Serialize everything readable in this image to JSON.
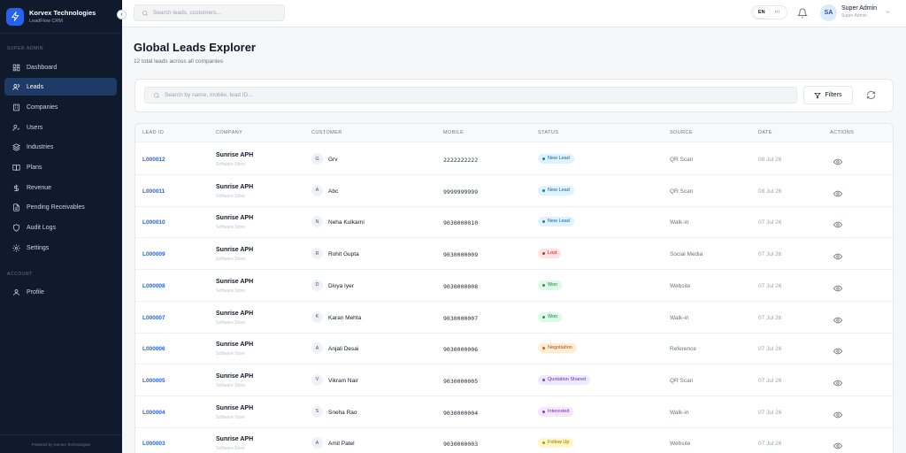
{
  "sidebar": {
    "brand_name": "Korvex Technologies",
    "brand_sub": "LeadFlow CRM",
    "section_admin": "SUPER ADMIN",
    "section_account": "ACCOUNT",
    "items": [
      {
        "label": "Dashboard",
        "icon": "dashboard-icon"
      },
      {
        "label": "Leads",
        "icon": "users-icon",
        "active": true
      },
      {
        "label": "Companies",
        "icon": "building-icon"
      },
      {
        "label": "Users",
        "icon": "user-group-icon"
      },
      {
        "label": "Industries",
        "icon": "layers-icon"
      },
      {
        "label": "Plans",
        "icon": "book-icon"
      },
      {
        "label": "Revenue",
        "icon": "dollar-icon"
      },
      {
        "label": "Pending Receivables",
        "icon": "file-icon"
      },
      {
        "label": "Audit Logs",
        "icon": "shield-icon"
      },
      {
        "label": "Settings",
        "icon": "gear-icon"
      }
    ],
    "profile_label": "Profile",
    "powered_by": "Powered by Korvex Technologies"
  },
  "topbar": {
    "search_placeholder": "Search leads, customers...",
    "lang_en": "EN",
    "lang_hi": "HI",
    "avatar_initials": "SA",
    "user_name": "Super Admin",
    "user_role": "Super Admin"
  },
  "page": {
    "title": "Global Leads Explorer",
    "subtitle": "12 total leads across all companies"
  },
  "filters": {
    "search_placeholder": "Search by name, mobile, lead ID...",
    "filters_label": "Filters"
  },
  "table": {
    "headers": [
      "LEAD ID",
      "COMPANY",
      "CUSTOMER",
      "MOBILE",
      "STATUS",
      "SOURCE",
      "DATE",
      "ACTIONS"
    ],
    "rows": [
      {
        "id": "L000012",
        "company": "Sunrise APH",
        "company_sub": "Software Store",
        "initial": "G",
        "customer": "Grv",
        "mobile": "2222222222",
        "status": "New Lead",
        "status_key": "new",
        "source": "QR Scan",
        "date": "08 Jul 26"
      },
      {
        "id": "L000011",
        "company": "Sunrise APH",
        "company_sub": "Software Store",
        "initial": "A",
        "customer": "Abc",
        "mobile": "9999999999",
        "status": "New Lead",
        "status_key": "new",
        "source": "QR Scan",
        "date": "08 Jul 26"
      },
      {
        "id": "L000010",
        "company": "Sunrise APH",
        "company_sub": "Software Store",
        "initial": "N",
        "customer": "Neha Kulkarni",
        "mobile": "9030000010",
        "status": "New Lead",
        "status_key": "new",
        "source": "Walk-in",
        "date": "07 Jul 26"
      },
      {
        "id": "L000009",
        "company": "Sunrise APH",
        "company_sub": "Software Store",
        "initial": "R",
        "customer": "Rohit Gupta",
        "mobile": "9030000009",
        "status": "Lost",
        "status_key": "lost",
        "source": "Social Media",
        "date": "07 Jul 26"
      },
      {
        "id": "L000008",
        "company": "Sunrise APH",
        "company_sub": "Software Store",
        "initial": "D",
        "customer": "Divya Iyer",
        "mobile": "9030000008",
        "status": "Won",
        "status_key": "won",
        "source": "Website",
        "date": "07 Jul 26"
      },
      {
        "id": "L000007",
        "company": "Sunrise APH",
        "company_sub": "Software Store",
        "initial": "K",
        "customer": "Karan Mehta",
        "mobile": "9030000007",
        "status": "Won",
        "status_key": "won",
        "source": "Walk-in",
        "date": "07 Jul 26"
      },
      {
        "id": "L000006",
        "company": "Sunrise APH",
        "company_sub": "Software Store",
        "initial": "A",
        "customer": "Anjali Desai",
        "mobile": "9030000006",
        "status": "Negotiation",
        "status_key": "negotiation",
        "source": "Reference",
        "date": "07 Jul 26"
      },
      {
        "id": "L000005",
        "company": "Sunrise APH",
        "company_sub": "Software Store",
        "initial": "V",
        "customer": "Vikram Nair",
        "mobile": "9030000005",
        "status": "Quotation Shared",
        "status_key": "quotation",
        "source": "QR Scan",
        "date": "07 Jul 26"
      },
      {
        "id": "L000004",
        "company": "Sunrise APH",
        "company_sub": "Software Store",
        "initial": "S",
        "customer": "Sneha Rao",
        "mobile": "9030000004",
        "status": "Interested",
        "status_key": "interested",
        "source": "Walk-in",
        "date": "07 Jul 26"
      },
      {
        "id": "L000003",
        "company": "Sunrise APH",
        "company_sub": "Software Store",
        "initial": "A",
        "customer": "Amit Patel",
        "mobile": "9030000003",
        "status": "Follow Up",
        "status_key": "followup",
        "source": "Website",
        "date": "07 Jul 26"
      }
    ]
  },
  "colors": {
    "sidebar_bg": "#0f1b2d",
    "active_nav": "#1e3a66",
    "accent": "#2563eb",
    "status": {
      "new": {
        "bg": "#e0f2fe",
        "fg": "#0369a1",
        "dot": "#0284c7"
      },
      "lost": {
        "bg": "#fee2e2",
        "fg": "#b91c1c",
        "dot": "#dc2626"
      },
      "won": {
        "bg": "#dcfce7",
        "fg": "#15803d",
        "dot": "#16a34a"
      },
      "negotiation": {
        "bg": "#ffedd5",
        "fg": "#c2410c",
        "dot": "#ea580c"
      },
      "quotation": {
        "bg": "#ede9fe",
        "fg": "#6d28d9",
        "dot": "#7c3aed"
      },
      "interested": {
        "bg": "#f3e8ff",
        "fg": "#7e22ce",
        "dot": "#9333ea"
      },
      "followup": {
        "bg": "#fef9c3",
        "fg": "#a16207",
        "dot": "#ca8a04"
      }
    }
  }
}
